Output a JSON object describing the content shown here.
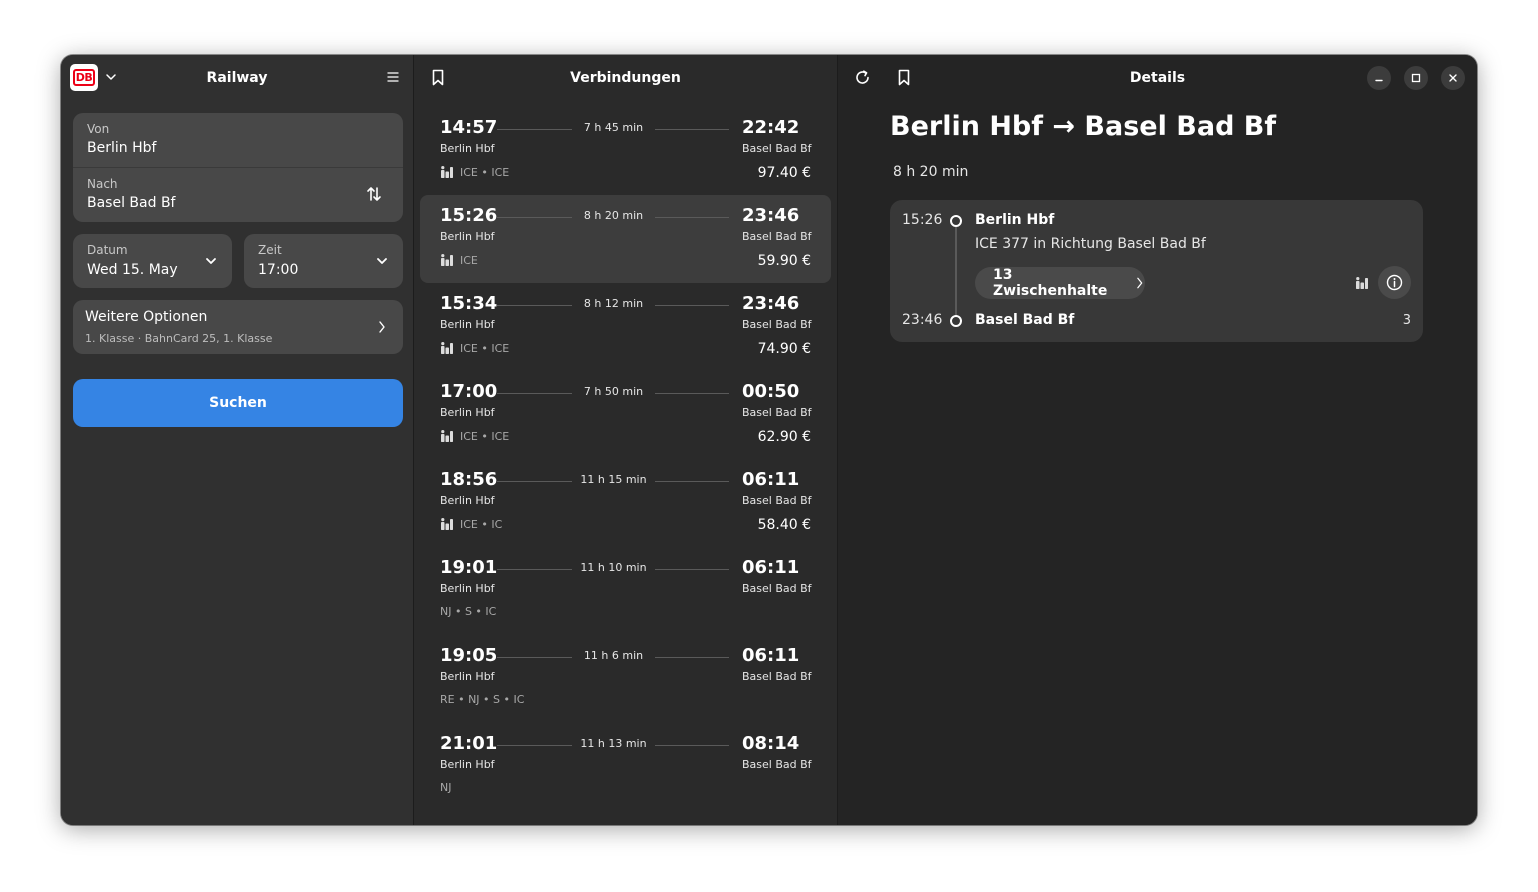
{
  "sidebar": {
    "title": "Railway",
    "logo_text": "DB",
    "from_label": "Von",
    "from_value": "Berlin Hbf",
    "to_label": "Nach",
    "to_value": "Basel Bad Bf",
    "date_label": "Datum",
    "date_value": "Wed 15. May",
    "time_label": "Zeit",
    "time_value": "17:00",
    "options_title": "Weitere Optionen",
    "options_subtitle": "1. Klasse · BahnCard 25, 1. Klasse",
    "search_label": "Suchen"
  },
  "connections": {
    "title": "Verbindungen",
    "items": [
      {
        "dep": "14:57",
        "arr": "22:42",
        "duration": "7 h 45 min",
        "from": "Berlin Hbf",
        "to": "Basel Bad Bf",
        "trains": "ICE • ICE",
        "price": "97.40 €",
        "seat_icon": true
      },
      {
        "dep": "15:26",
        "arr": "23:46",
        "duration": "8 h 20 min",
        "from": "Berlin Hbf",
        "to": "Basel Bad Bf",
        "trains": "ICE",
        "price": "59.90 €",
        "seat_icon": true,
        "selected": true
      },
      {
        "dep": "15:34",
        "arr": "23:46",
        "duration": "8 h 12 min",
        "from": "Berlin Hbf",
        "to": "Basel Bad Bf",
        "trains": "ICE • ICE",
        "price": "74.90 €",
        "seat_icon": true
      },
      {
        "dep": "17:00",
        "arr": "00:50",
        "duration": "7 h 50 min",
        "from": "Berlin Hbf",
        "to": "Basel Bad Bf",
        "trains": "ICE • ICE",
        "price": "62.90 €",
        "seat_icon": true
      },
      {
        "dep": "18:56",
        "arr": "06:11",
        "duration": "11 h 15 min",
        "from": "Berlin Hbf",
        "to": "Basel Bad Bf",
        "trains": "ICE • IC",
        "price": "58.40 €",
        "seat_icon": true
      },
      {
        "dep": "19:01",
        "arr": "06:11",
        "duration": "11 h 10 min",
        "from": "Berlin Hbf",
        "to": "Basel Bad Bf",
        "trains": "NJ • S • IC",
        "price": "",
        "seat_icon": false
      },
      {
        "dep": "19:05",
        "arr": "06:11",
        "duration": "11 h  6 min",
        "from": "Berlin Hbf",
        "to": "Basel Bad Bf",
        "trains": "RE • NJ • S • IC",
        "price": "",
        "seat_icon": false
      },
      {
        "dep": "21:01",
        "arr": "08:14",
        "duration": "11 h 13 min",
        "from": "Berlin Hbf",
        "to": "Basel Bad Bf",
        "trains": "NJ",
        "price": "",
        "seat_icon": false
      }
    ]
  },
  "details": {
    "title": "Details",
    "route": "Berlin Hbf → Basel Bad Bf",
    "duration": "8 h 20 min",
    "leg": {
      "dep_time": "15:26",
      "dep_station": "Berlin Hbf",
      "train": "ICE 377 in Richtung Basel Bad Bf",
      "stops": "13 Zwischenhalte",
      "arr_time": "23:46",
      "arr_station": "Basel Bad Bf",
      "platform": "3"
    }
  },
  "colors": {
    "accent": "#3584e4",
    "db_red": "#ec0016",
    "sidebar_bg": "#303030",
    "list_bg": "#2a2a2a",
    "details_bg": "#242424"
  },
  "icons": [
    "db-logo",
    "chevron-down-icon",
    "menu-icon",
    "swap-icon",
    "chevron-right-icon",
    "bookmark-icon",
    "refresh-icon",
    "minimize-icon",
    "maximize-icon",
    "close-icon",
    "seat-icon",
    "info-icon"
  ]
}
